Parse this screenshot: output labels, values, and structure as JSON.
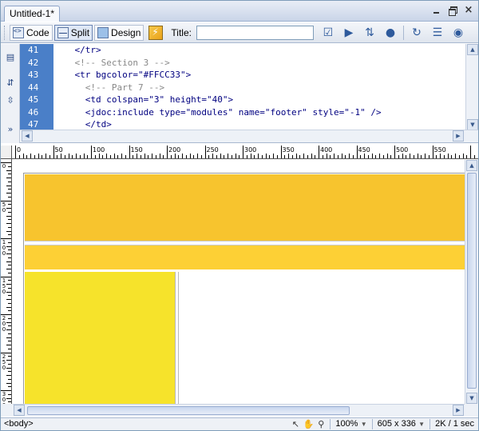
{
  "document": {
    "tab_title": "Untitled-1*"
  },
  "toolbar": {
    "code_label": "Code",
    "split_label": "Split",
    "design_label": "Design",
    "title_label": "Title:",
    "title_value": ""
  },
  "code": {
    "line_numbers": [
      "41",
      "42",
      "43",
      "44",
      "45",
      "46",
      "47"
    ],
    "lines": [
      "    </tr>",
      "    <!-- Section 3 -->",
      "    <tr bgcolor=\"#FFCC33\">",
      "      <!-- Part 7 -->",
      "      <td colspan=\"3\" height=\"40\">",
      "      <jdoc:include type=\"modules\" name=\"footer\" style=\"-1\" />",
      "      </td>"
    ]
  },
  "ruler": {
    "top_labels": [
      "0",
      "50",
      "100",
      "150",
      "200",
      "250",
      "300",
      "350",
      "400",
      "450",
      "500",
      "550"
    ],
    "left_labels": [
      "0",
      "50",
      "100",
      "150",
      "200",
      "250",
      "300"
    ]
  },
  "design": {
    "band1_color": "#F7C42E",
    "band2_color": "#FDD035",
    "left_col_color": "#F6E32B"
  },
  "status": {
    "tag_selector": "<body>",
    "zoom": "100%",
    "window_size": "605 x 336",
    "download": "2K / 1 sec"
  }
}
